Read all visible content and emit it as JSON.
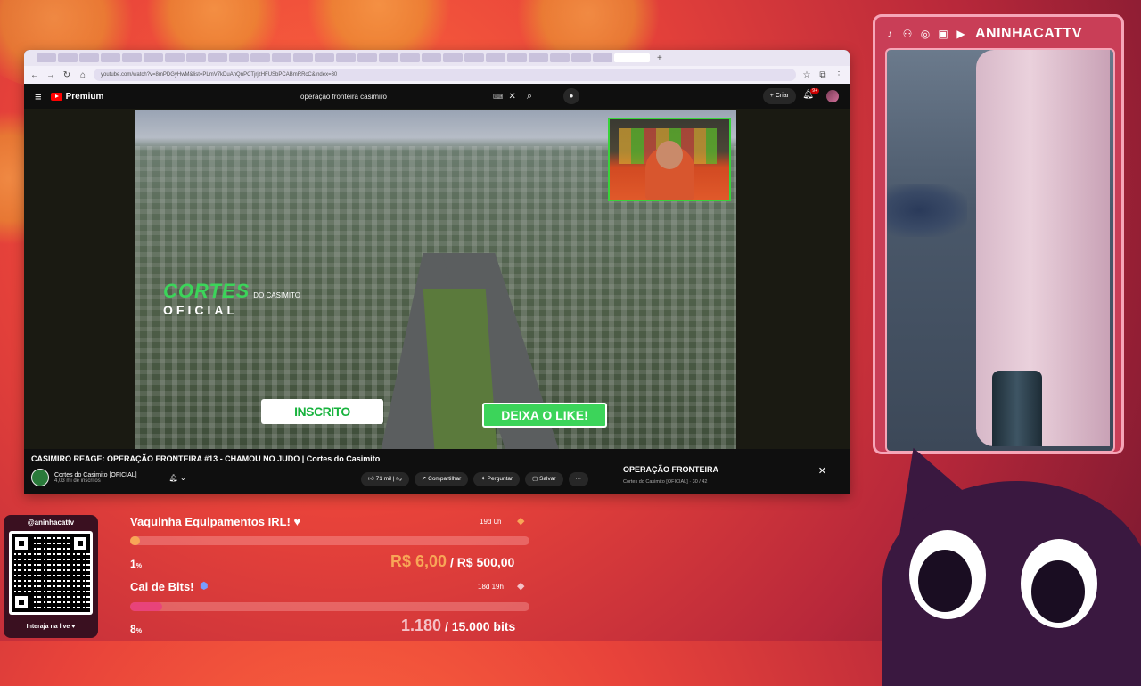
{
  "browser": {
    "url": "youtube.com/watch?v=8mPDGyHwM&list=PLmV7kDuAhQnPCTjrjzHFUSbPCABmRRcC&index=30",
    "tab_count": 28
  },
  "youtube": {
    "premium_label": "Premium",
    "search_query": "operação fronteira casimiro",
    "create_label": "Criar",
    "notifications_badge": "9+",
    "video_title": "CASIMIRO REAGE: OPERAÇÃO FRONTEIRA #13 - CHAMOU NO JUDO | Cortes do Casimito",
    "channel_name": "Cortes do Casimito [OFICIAL]",
    "channel_subs": "4,03 mi de inscritos",
    "likes": "71 mil",
    "share_label": "Compartilhar",
    "ask_label": "Perguntar",
    "save_label": "Salvar",
    "overlay_logo_cortes": "CORTES",
    "overlay_logo_do": "DO CASIMITO",
    "overlay_logo_oficial": "OFICIAL",
    "overlay_inscrito": "INSCRITO",
    "overlay_like": "DEIXA O LIKE!",
    "playlist_title": "OPERAÇÃO FRONTEIRA",
    "playlist_sub": "Cortes do Casimito [OFICIAL] · 30 / 42"
  },
  "stream": {
    "handle": "ANINHACATTV",
    "qr_handle": "@aninhacattv",
    "qr_footer": "Interaja na live ♥"
  },
  "goals": [
    {
      "title": "Vaquinha Equipamentos IRL! ♥",
      "time": "19d 0h",
      "percent": "1",
      "percent_unit": "%",
      "current": "R$ 6,00",
      "separator": "/",
      "target": "R$ 500,00",
      "progress": 0.01,
      "fill_color": "#f8a657"
    },
    {
      "title": "Cai de Bits!",
      "time": "18d 19h",
      "percent": "8",
      "percent_unit": "%",
      "current": "1.180",
      "separator": "/",
      "target": "15.000 bits",
      "progress": 0.08,
      "fill_color": "#e8437a"
    }
  ]
}
